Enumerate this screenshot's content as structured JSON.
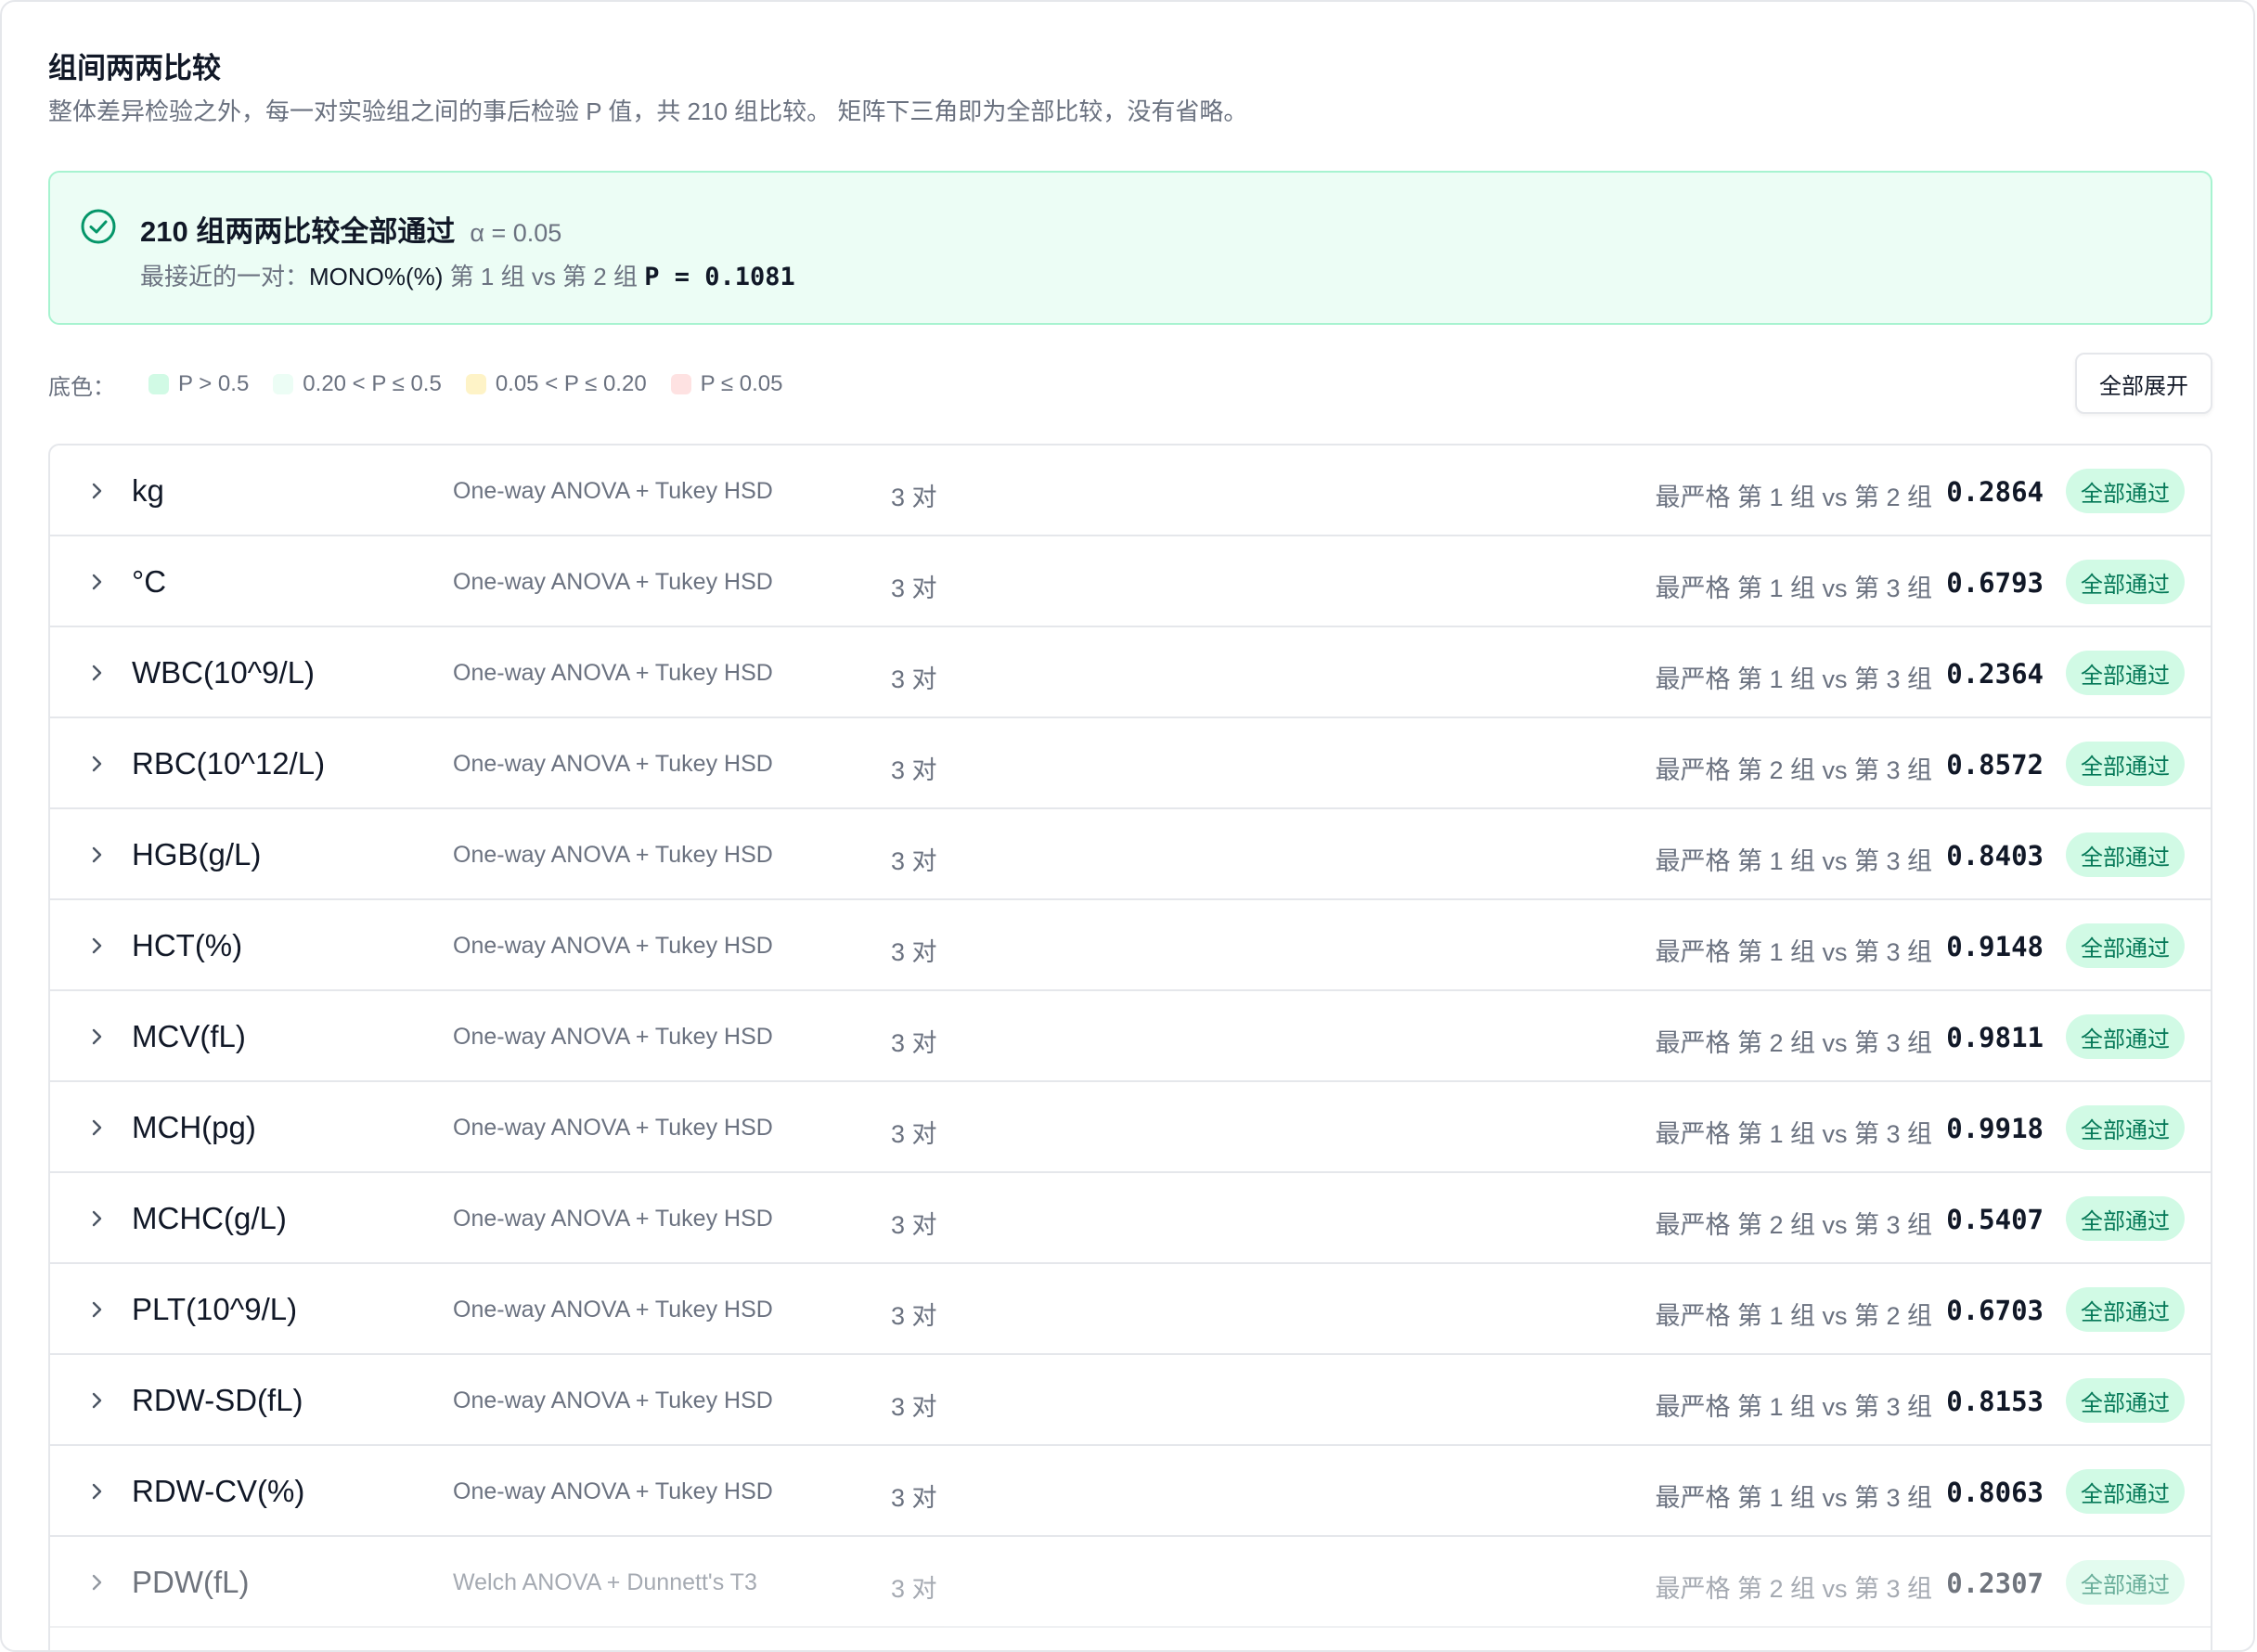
{
  "header": {
    "title": "组间两两比较",
    "description": "整体差异检验之外，每一对实验组之间的事后检验 P 值，共 210 组比较。 矩阵下三角即为全部比较，没有省略。"
  },
  "summary": {
    "title": "210 组两两比较全部通过",
    "alpha": "α = 0.05",
    "closest_label": "最接近的一对：",
    "closest_metric": "MONO%(%)",
    "closest_pair": "第 1 组 vs 第 2 组",
    "closest_p": "P = 0.1081",
    "icon": "check-circle-icon"
  },
  "legend": {
    "label": "底色：",
    "items": [
      {
        "label": "P > 0.5",
        "color": "#d1fae5"
      },
      {
        "label": "0.20 < P ≤ 0.5",
        "color": "#ecfdf5"
      },
      {
        "label": "0.05 < P ≤ 0.20",
        "color": "#fef3c7"
      },
      {
        "label": "P ≤ 0.05",
        "color": "#fee2e2"
      }
    ]
  },
  "expand_all_label": "全部展开",
  "colors": {
    "accent": "#047857",
    "badge_bg": "#d1fae5",
    "summary_bg": "#ecfdf5",
    "summary_border": "#a7f3d0"
  },
  "rows": [
    {
      "name": "kg",
      "method": "One-way ANOVA + Tukey HSD",
      "pairs": "3 对",
      "worst": "最严格 第 1 组 vs 第 2 组",
      "p": "0.2864",
      "status": "全部通过"
    },
    {
      "name": "°C",
      "method": "One-way ANOVA + Tukey HSD",
      "pairs": "3 对",
      "worst": "最严格 第 1 组 vs 第 3 组",
      "p": "0.6793",
      "status": "全部通过"
    },
    {
      "name": "WBC(10^9/L)",
      "method": "One-way ANOVA + Tukey HSD",
      "pairs": "3 对",
      "worst": "最严格 第 1 组 vs 第 3 组",
      "p": "0.2364",
      "status": "全部通过"
    },
    {
      "name": "RBC(10^12/L)",
      "method": "One-way ANOVA + Tukey HSD",
      "pairs": "3 对",
      "worst": "最严格 第 2 组 vs 第 3 组",
      "p": "0.8572",
      "status": "全部通过"
    },
    {
      "name": "HGB(g/L)",
      "method": "One-way ANOVA + Tukey HSD",
      "pairs": "3 对",
      "worst": "最严格 第 1 组 vs 第 3 组",
      "p": "0.8403",
      "status": "全部通过"
    },
    {
      "name": "HCT(%)",
      "method": "One-way ANOVA + Tukey HSD",
      "pairs": "3 对",
      "worst": "最严格 第 1 组 vs 第 3 组",
      "p": "0.9148",
      "status": "全部通过"
    },
    {
      "name": "MCV(fL)",
      "method": "One-way ANOVA + Tukey HSD",
      "pairs": "3 对",
      "worst": "最严格 第 2 组 vs 第 3 组",
      "p": "0.9811",
      "status": "全部通过"
    },
    {
      "name": "MCH(pg)",
      "method": "One-way ANOVA + Tukey HSD",
      "pairs": "3 对",
      "worst": "最严格 第 1 组 vs 第 3 组",
      "p": "0.9918",
      "status": "全部通过"
    },
    {
      "name": "MCHC(g/L)",
      "method": "One-way ANOVA + Tukey HSD",
      "pairs": "3 对",
      "worst": "最严格 第 2 组 vs 第 3 组",
      "p": "0.5407",
      "status": "全部通过"
    },
    {
      "name": "PLT(10^9/L)",
      "method": "One-way ANOVA + Tukey HSD",
      "pairs": "3 对",
      "worst": "最严格 第 1 组 vs 第 2 组",
      "p": "0.6703",
      "status": "全部通过"
    },
    {
      "name": "RDW-SD(fL)",
      "method": "One-way ANOVA + Tukey HSD",
      "pairs": "3 对",
      "worst": "最严格 第 1 组 vs 第 3 组",
      "p": "0.8153",
      "status": "全部通过"
    },
    {
      "name": "RDW-CV(%)",
      "method": "One-way ANOVA + Tukey HSD",
      "pairs": "3 对",
      "worst": "最严格 第 1 组 vs 第 3 组",
      "p": "0.8063",
      "status": "全部通过"
    },
    {
      "name": "PDW(fL)",
      "method": "Welch ANOVA + Dunnett's T3",
      "pairs": "3 对",
      "worst": "最严格 第 2 组 vs 第 3 组",
      "p": "0.2307",
      "status": "全部通过"
    }
  ]
}
